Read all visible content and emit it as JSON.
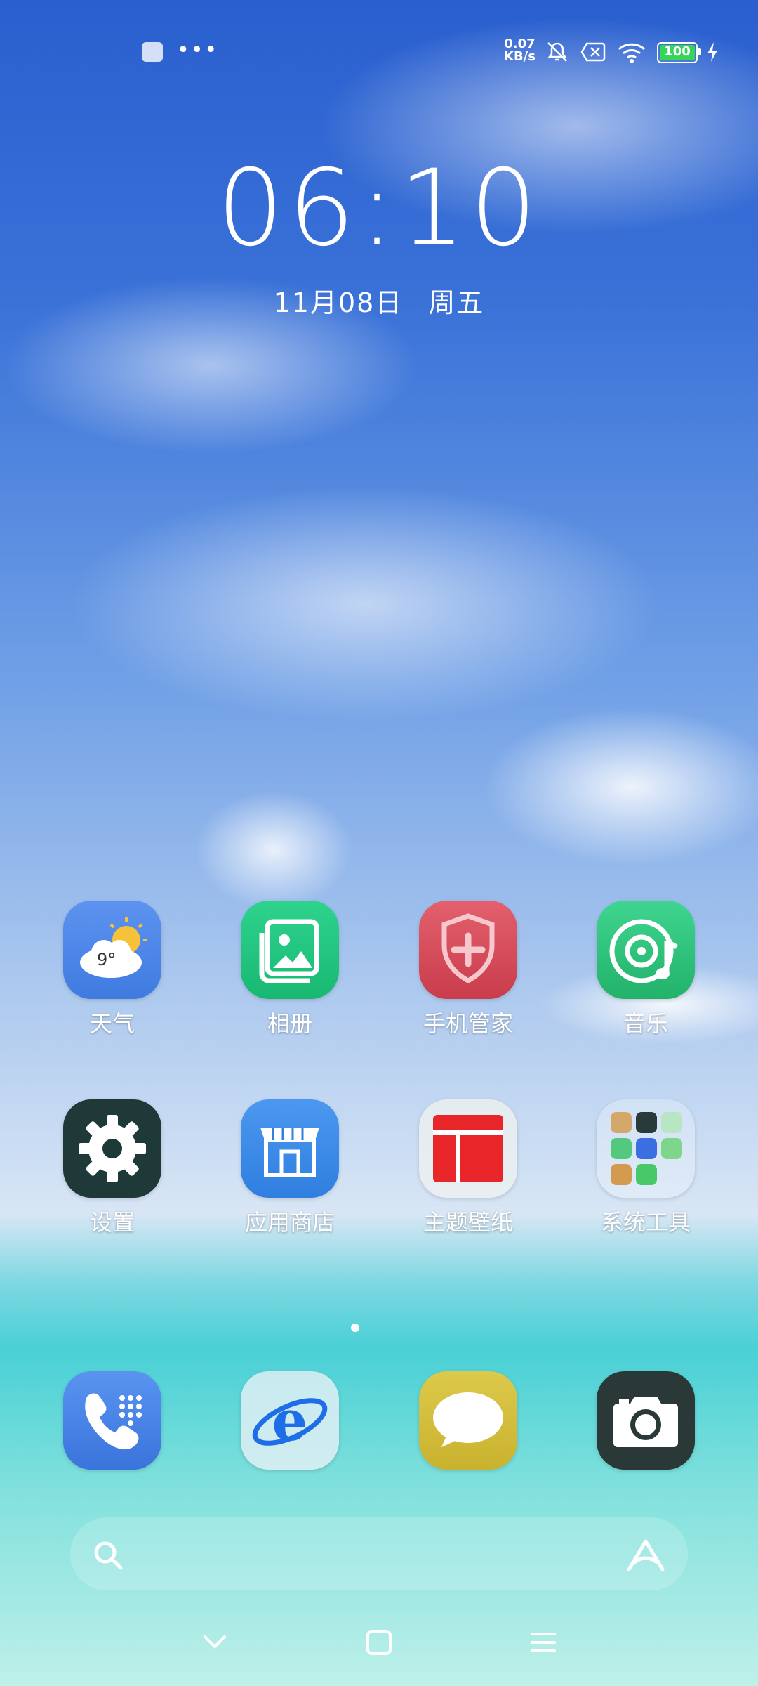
{
  "status_bar": {
    "net_speed_value": "0.07",
    "net_speed_unit": "KB/s",
    "battery_level": "100"
  },
  "clock": {
    "time": "06:10",
    "date": "11月08日",
    "weekday": "周五"
  },
  "weather_widget_temp": "9°",
  "apps_row1": [
    {
      "label": "天气",
      "icon": "weather-icon"
    },
    {
      "label": "相册",
      "icon": "gallery-icon"
    },
    {
      "label": "手机管家",
      "icon": "phone-manager-icon"
    },
    {
      "label": "音乐",
      "icon": "music-icon"
    }
  ],
  "apps_row2": [
    {
      "label": "设置",
      "icon": "settings-icon"
    },
    {
      "label": "应用商店",
      "icon": "app-store-icon"
    },
    {
      "label": "主题壁纸",
      "icon": "themes-icon"
    },
    {
      "label": "系统工具",
      "icon": "system-tools-folder-icon"
    }
  ],
  "dock": [
    {
      "icon": "phone-icon"
    },
    {
      "icon": "browser-icon"
    },
    {
      "icon": "messages-icon"
    },
    {
      "icon": "camera-icon"
    }
  ],
  "colors": {
    "phone_manager_red": "#d94a5a",
    "music_green": "#32c47a",
    "gallery_green": "#22c783",
    "settings_dark": "#1f3a3a",
    "store_blue": "#3b8ce8",
    "themes_red": "#e8262a",
    "dock_phone_blue": "#4a86e8",
    "dock_msg_yellow": "#d6c43a",
    "battery_green": "#37d45a"
  }
}
